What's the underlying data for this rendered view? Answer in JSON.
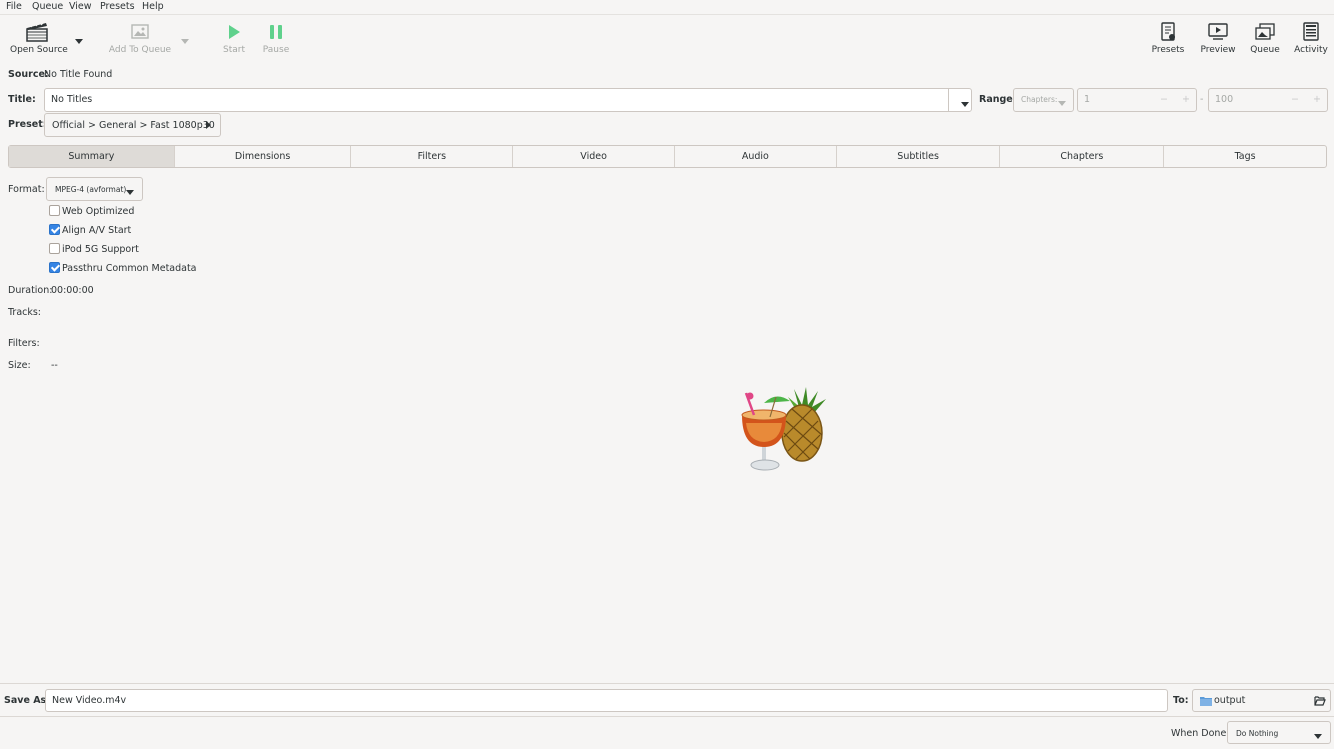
{
  "menubar": {
    "items": [
      "File",
      "Queue",
      "View",
      "Presets",
      "Help"
    ]
  },
  "toolbar": {
    "open_source": "Open Source",
    "add_to_queue": "Add To Queue",
    "start": "Start",
    "pause": "Pause",
    "presets": "Presets",
    "preview": "Preview",
    "queue": "Queue",
    "activity": "Activity"
  },
  "source": {
    "label": "Source:",
    "value": "No Title Found"
  },
  "title": {
    "label": "Title:",
    "value": "No Titles"
  },
  "range": {
    "label": "Range:",
    "mode": "Chapters:",
    "start": "1",
    "separator": "-",
    "end": "100",
    "minus": "−",
    "plus": "+"
  },
  "preset": {
    "label": "Preset:",
    "value": "Official > General > Fast 1080p30"
  },
  "tabs": [
    "Summary",
    "Dimensions",
    "Filters",
    "Video",
    "Audio",
    "Subtitles",
    "Chapters",
    "Tags"
  ],
  "summary": {
    "format_label": "Format:",
    "format_value": "MPEG-4 (avformat)",
    "options": [
      {
        "label": "Web Optimized",
        "checked": false
      },
      {
        "label": "Align A/V Start",
        "checked": true
      },
      {
        "label": "iPod 5G Support",
        "checked": false
      },
      {
        "label": "Passthru Common Metadata",
        "checked": true
      }
    ],
    "duration_label": "Duration:",
    "duration_value": "00:00:00",
    "tracks_label": "Tracks:",
    "filters_label": "Filters:",
    "size_label": "Size:",
    "size_value": "--"
  },
  "save": {
    "label": "Save As:",
    "value": "New Video.m4v",
    "to_label": "To:",
    "folder": "output"
  },
  "when_done": {
    "label": "When Done:",
    "value": "Do Nothing"
  },
  "colors": {
    "accent": "#3584e4",
    "play_green": "#5fd18c",
    "text": "#2e3436",
    "bg": "#f6f5f4"
  }
}
